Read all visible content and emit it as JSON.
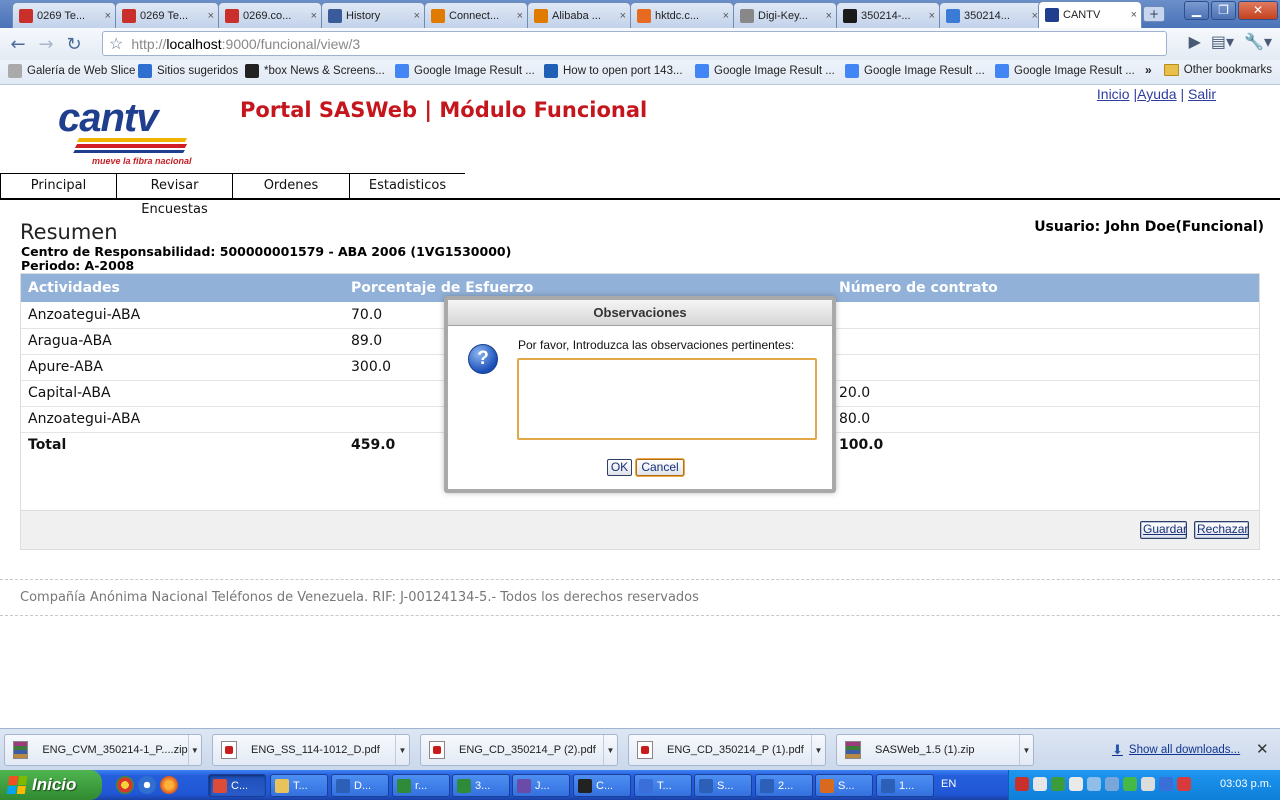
{
  "browser": {
    "tabs": [
      {
        "label": "0269 Te...",
        "icon": "gmail-icon",
        "color": "#c9302c"
      },
      {
        "label": "0269 Te...",
        "icon": "gmail-icon",
        "color": "#c9302c"
      },
      {
        "label": "0269.co...",
        "icon": "gmail-icon",
        "color": "#c9302c"
      },
      {
        "label": "History",
        "icon": "history-icon",
        "color": "#3a5b9a"
      },
      {
        "label": "Connect...",
        "icon": "alibaba-icon",
        "color": "#e07b00"
      },
      {
        "label": "Alibaba ...",
        "icon": "alibaba-icon",
        "color": "#e07b00"
      },
      {
        "label": "hktdc.c...",
        "icon": "chart-icon",
        "color": "#e66a1f"
      },
      {
        "label": "Digi-Key...",
        "icon": "page-icon",
        "color": "#888888"
      },
      {
        "label": "350214-...",
        "icon": "m-icon",
        "color": "#1a1a1a"
      },
      {
        "label": "350214...",
        "icon": "stack-icon",
        "color": "#3a7bd5"
      },
      {
        "label": "CANTV",
        "icon": "cantv-icon",
        "color": "#1f3f8e"
      }
    ],
    "window_buttons": {
      "minimize": "▁",
      "maximize": "❐",
      "close": "✕"
    },
    "new_tab": "+",
    "address": {
      "scheme": "http://",
      "host": "localhost",
      "rest": ":9000/funcional/view/3"
    },
    "bookmarks": [
      {
        "label": "Galería de Web Slice",
        "icon": "page-icon"
      },
      {
        "label": "Sitios sugeridos",
        "icon": "ie-icon"
      },
      {
        "label": "*box News & Screens...",
        "icon": "xbox-icon"
      },
      {
        "label": "Google Image Result ...",
        "icon": "google-icon"
      },
      {
        "label": "How to open port 143...",
        "icon": "plus-icon"
      },
      {
        "label": "Google Image Result ...",
        "icon": "google-icon"
      },
      {
        "label": "Google Image Result ...",
        "icon": "google-icon"
      },
      {
        "label": "Google Image Result ...",
        "icon": "google-icon"
      }
    ],
    "bookmarks_more": "»",
    "other_bookmarks": "Other bookmarks"
  },
  "site": {
    "logo_word": "cantv",
    "logo_tagline": "mueve la fibra nacional",
    "title": "Portal SASWeb | Módulo Funcional",
    "links": {
      "inicio": "Inicio",
      "ayuda": "Ayuda",
      "salir": "Salir",
      "sep": "|"
    },
    "menu": [
      "Principal",
      "Revisar Encuestas",
      "Ordenes",
      "Estadisticos"
    ],
    "section_title": "Resumen",
    "usuario": "Usuario: John Doe(Funcional)",
    "centro": "Centro de Responsabilidad: 500000001579 - ABA 2006 (1VG1530000)",
    "periodo": "Periodo: A-2008",
    "table": {
      "headers": [
        "Actividades",
        "Porcentaje de Esfuerzo",
        "Número de contrato"
      ],
      "rows": [
        {
          "actividad": "Anzoategui-ABA",
          "porcentaje": "70.0",
          "contrato": ""
        },
        {
          "actividad": "Aragua-ABA",
          "porcentaje": "89.0",
          "contrato": ""
        },
        {
          "actividad": "Apure-ABA",
          "porcentaje": "300.0",
          "contrato": ""
        },
        {
          "actividad": "Capital-ABA",
          "porcentaje": "",
          "contrato": "20.0"
        },
        {
          "actividad": "Anzoategui-ABA",
          "porcentaje": "",
          "contrato": "80.0"
        }
      ],
      "total": {
        "label": "Total",
        "porcentaje": "459.0",
        "contrato": "100.0"
      }
    },
    "buttons": {
      "guardar": "Guardar",
      "rechazar": "Rechazar"
    },
    "footer": "Compañía Anónima Nacional Teléfonos de Venezuela. RIF: J-00124134-5.- Todos los derechos reservados"
  },
  "modal": {
    "title": "Observaciones",
    "prompt": "Por favor, Introduzca las observaciones pertinentes:",
    "value": "",
    "ok": "OK",
    "cancel": "Cancel"
  },
  "downloads": {
    "items": [
      {
        "name": "ENG_CVM_350214-1_P....zip",
        "type": "zip"
      },
      {
        "name": "ENG_SS_114-1012_D.pdf",
        "type": "pdf"
      },
      {
        "name": "ENG_CD_350214_P (2).pdf",
        "type": "pdf"
      },
      {
        "name": "ENG_CD_350214_P (1).pdf",
        "type": "pdf"
      },
      {
        "name": "SASWeb_1.5 (1).zip",
        "type": "zip"
      }
    ],
    "show_all": "Show all downloads...",
    "close": "✕"
  },
  "taskbar": {
    "start": "Inicio",
    "tasks": [
      "C...",
      "T...",
      "D...",
      "r...",
      "3...",
      "J...",
      "C...",
      "T...",
      "S...",
      "2...",
      "S...",
      "1..."
    ],
    "lang": "EN",
    "clock": "03:03 p.m."
  },
  "colors": {
    "brand_red": "#c4161c",
    "brand_blue": "#1f3f8e",
    "table_header": "#92b1d9"
  }
}
